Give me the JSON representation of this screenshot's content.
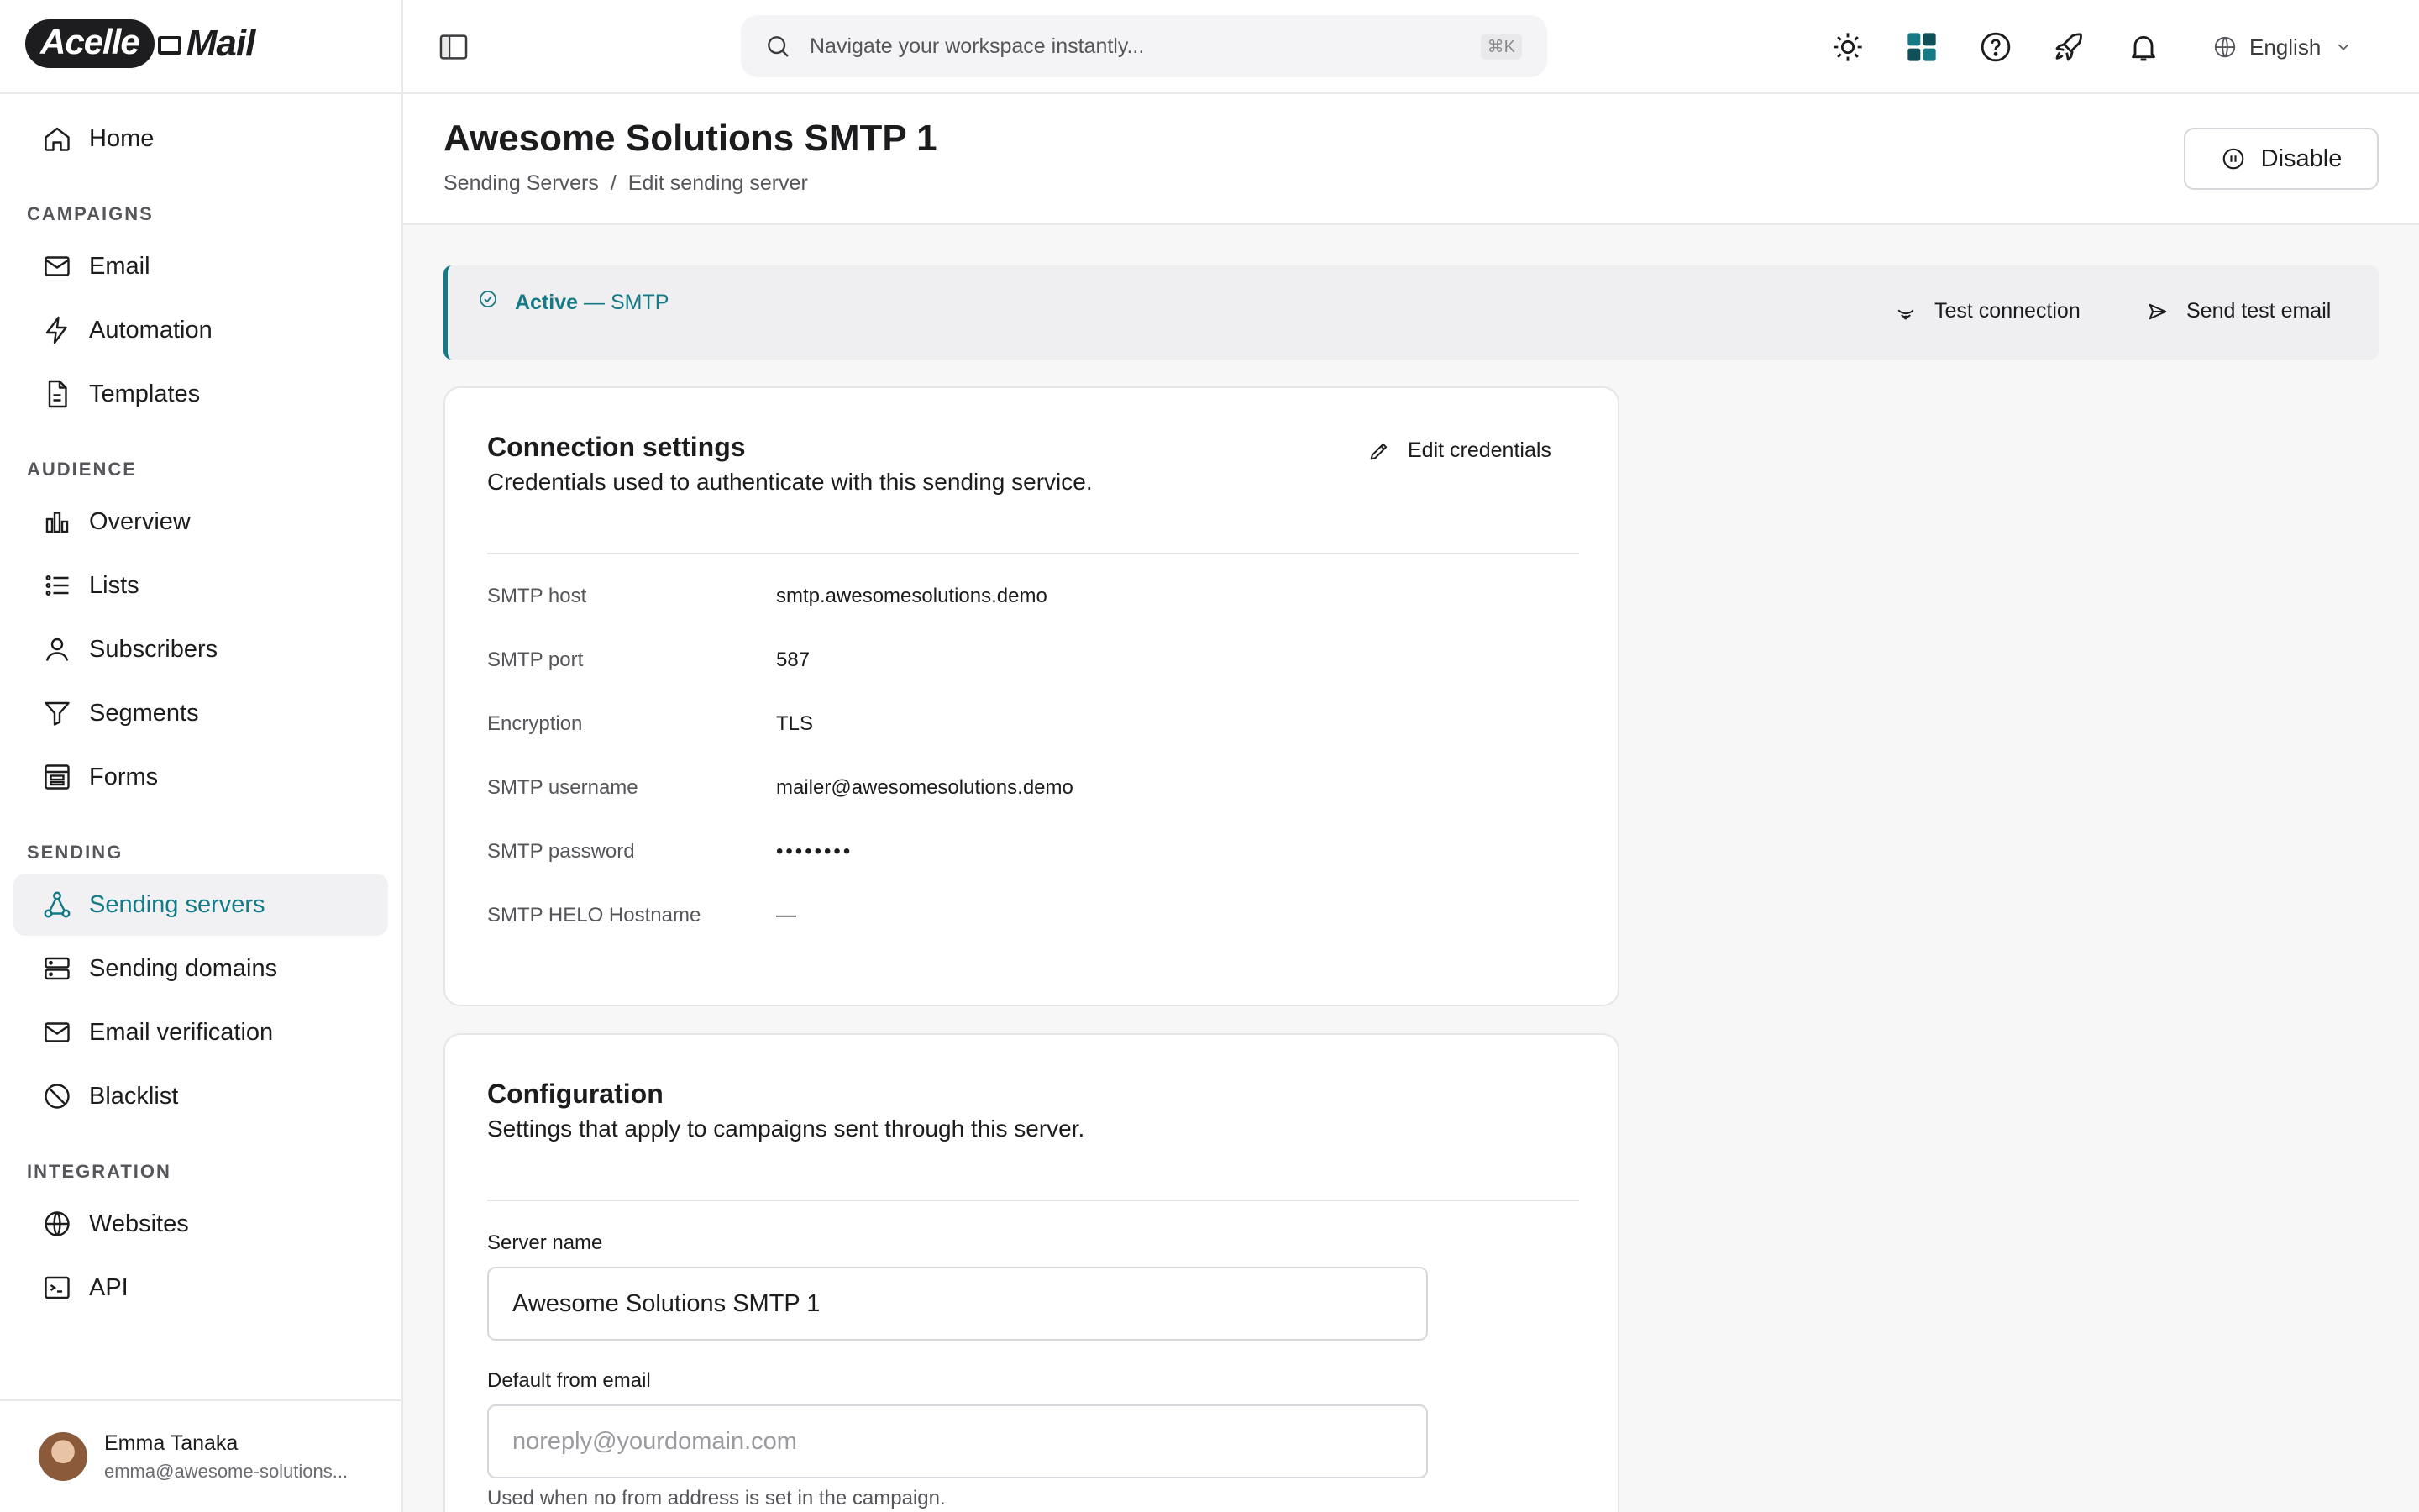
{
  "brand": {
    "logo_left": "Acelle",
    "logo_right": "Mail"
  },
  "sidebar": {
    "home": "Home",
    "sections": {
      "campaigns": "CAMPAIGNS",
      "audience": "AUDIENCE",
      "sending": "SENDING",
      "integration": "INTEGRATION"
    },
    "items": {
      "email": "Email",
      "automation": "Automation",
      "templates": "Templates",
      "overview": "Overview",
      "lists": "Lists",
      "subscribers": "Subscribers",
      "segments": "Segments",
      "forms": "Forms",
      "sending_servers": "Sending servers",
      "sending_domains": "Sending domains",
      "email_verification": "Email verification",
      "blacklist": "Blacklist",
      "websites": "Websites",
      "api": "API"
    },
    "active_item": "sending_servers",
    "user": {
      "name": "Emma Tanaka",
      "email": "emma@awesome-solutions..."
    }
  },
  "topbar": {
    "search_placeholder": "Navigate your workspace instantly...",
    "search_shortcut": "⌘K",
    "language": "English"
  },
  "page": {
    "title": "Awesome Solutions SMTP 1",
    "breadcrumb": [
      "Sending Servers",
      "/",
      "Edit sending server"
    ],
    "disable_label": "Disable"
  },
  "status": {
    "state": "Active",
    "type": " — SMTP",
    "test_connection": "Test connection",
    "send_test_email": "Send test email"
  },
  "connection": {
    "title": "Connection settings",
    "subtitle": "Credentials used to authenticate with this sending service.",
    "edit_label": "Edit credentials",
    "rows": [
      {
        "label": "SMTP host",
        "value": "smtp.awesomesolutions.demo"
      },
      {
        "label": "SMTP port",
        "value": "587"
      },
      {
        "label": "Encryption",
        "value": "TLS"
      },
      {
        "label": "SMTP username",
        "value": "mailer@awesomesolutions.demo"
      },
      {
        "label": "SMTP password",
        "value": "••••••••"
      },
      {
        "label": "SMTP HELO Hostname",
        "value": "—"
      }
    ]
  },
  "configuration": {
    "title": "Configuration",
    "subtitle": "Settings that apply to campaigns sent through this server.",
    "server_name_label": "Server name",
    "server_name_value": "Awesome Solutions SMTP 1",
    "from_email_label": "Default from email",
    "from_email_placeholder": "noreply@yourdomain.com",
    "from_email_help": "Used when no from address is set in the campaign."
  },
  "colors": {
    "accent": "#137a86",
    "border": "#e6e6e9",
    "muted": "#55565a"
  }
}
